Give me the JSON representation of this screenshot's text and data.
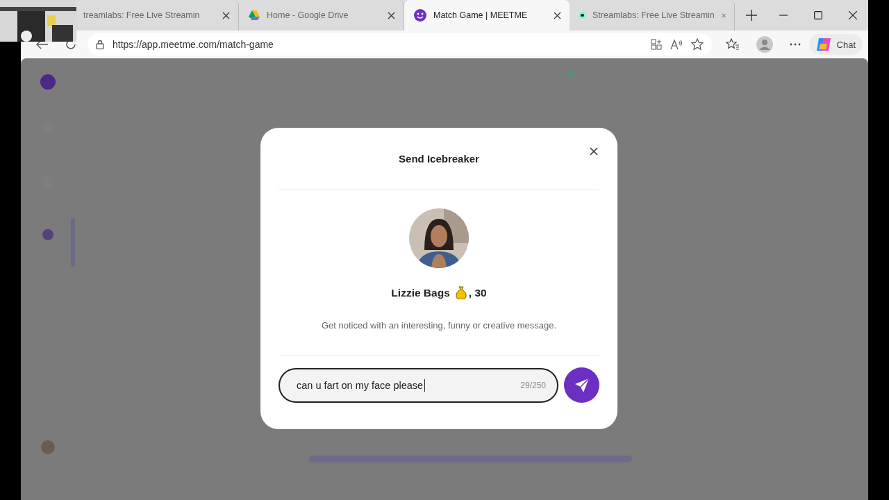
{
  "tabs": [
    {
      "title": "treamlabs: Free Live Streamin",
      "selected": false
    },
    {
      "title": "Home - Google Drive",
      "selected": false
    },
    {
      "title": "Match Game | MEETME",
      "selected": true
    },
    {
      "title": "Streamlabs: Free Live Streamin",
      "selected": false
    }
  ],
  "address_bar": {
    "url": "https://app.meetme.com/match-game"
  },
  "copilot": {
    "label": "Chat"
  },
  "dialog": {
    "title": "Send Icebreaker",
    "profile": {
      "name": "Lizzie Bags",
      "age_text": ", 30"
    },
    "hint": "Get noticed with an interesting, funny or creative message.",
    "message": {
      "value": "can u fart on my face please",
      "counter": "29/250"
    }
  }
}
